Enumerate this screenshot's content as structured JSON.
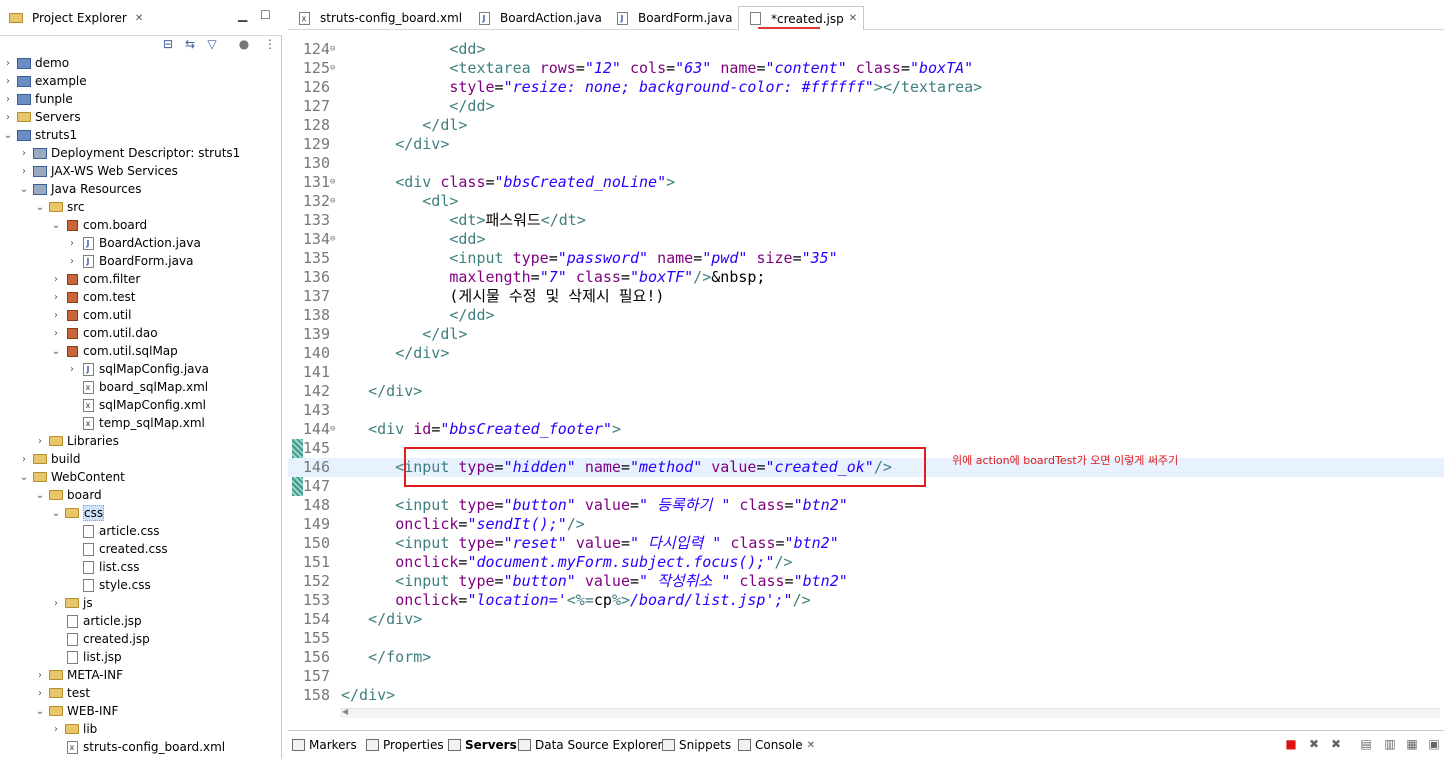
{
  "explorer": {
    "title": "Project Explorer",
    "tree": [
      {
        "label": "demo",
        "depth": 0,
        "arrow": ">",
        "icon": "project"
      },
      {
        "label": "example",
        "depth": 0,
        "arrow": ">",
        "icon": "project"
      },
      {
        "label": "funple",
        "depth": 0,
        "arrow": ">",
        "icon": "project"
      },
      {
        "label": "Servers",
        "depth": 0,
        "arrow": ">",
        "icon": "folder"
      },
      {
        "label": "struts1",
        "depth": 0,
        "arrow": "v",
        "icon": "project"
      },
      {
        "label": "Deployment Descriptor: struts1",
        "depth": 1,
        "arrow": ">",
        "icon": "descriptor"
      },
      {
        "label": "JAX-WS Web Services",
        "depth": 1,
        "arrow": ">",
        "icon": "descriptor"
      },
      {
        "label": "Java Resources",
        "depth": 1,
        "arrow": "v",
        "icon": "descriptor"
      },
      {
        "label": "src",
        "depth": 2,
        "arrow": "v",
        "icon": "folder"
      },
      {
        "label": "com.board",
        "depth": 3,
        "arrow": "v",
        "icon": "package"
      },
      {
        "label": "BoardAction.java",
        "depth": 4,
        "arrow": ">",
        "icon": "java"
      },
      {
        "label": "BoardForm.java",
        "depth": 4,
        "arrow": ">",
        "icon": "java"
      },
      {
        "label": "com.filter",
        "depth": 3,
        "arrow": ">",
        "icon": "package"
      },
      {
        "label": "com.test",
        "depth": 3,
        "arrow": ">",
        "icon": "package"
      },
      {
        "label": "com.util",
        "depth": 3,
        "arrow": ">",
        "icon": "package"
      },
      {
        "label": "com.util.dao",
        "depth": 3,
        "arrow": ">",
        "icon": "package"
      },
      {
        "label": "com.util.sqlMap",
        "depth": 3,
        "arrow": "v",
        "icon": "package"
      },
      {
        "label": "sqlMapConfig.java",
        "depth": 4,
        "arrow": ">",
        "icon": "java"
      },
      {
        "label": "board_sqlMap.xml",
        "depth": 4,
        "arrow": "",
        "icon": "xml"
      },
      {
        "label": "sqlMapConfig.xml",
        "depth": 4,
        "arrow": "",
        "icon": "xml"
      },
      {
        "label": "temp_sqlMap.xml",
        "depth": 4,
        "arrow": "",
        "icon": "xml"
      },
      {
        "label": "Libraries",
        "depth": 2,
        "arrow": ">",
        "icon": "folder"
      },
      {
        "label": "build",
        "depth": 1,
        "arrow": ">",
        "icon": "folder"
      },
      {
        "label": "WebContent",
        "depth": 1,
        "arrow": "v",
        "icon": "folder"
      },
      {
        "label": "board",
        "depth": 2,
        "arrow": "v",
        "icon": "folder"
      },
      {
        "label": "css",
        "depth": 3,
        "arrow": "v",
        "icon": "folder",
        "selected": true
      },
      {
        "label": "article.css",
        "depth": 4,
        "arrow": "",
        "icon": "css"
      },
      {
        "label": "created.css",
        "depth": 4,
        "arrow": "",
        "icon": "css"
      },
      {
        "label": "list.css",
        "depth": 4,
        "arrow": "",
        "icon": "css"
      },
      {
        "label": "style.css",
        "depth": 4,
        "arrow": "",
        "icon": "css"
      },
      {
        "label": "js",
        "depth": 3,
        "arrow": ">",
        "icon": "folder"
      },
      {
        "label": "article.jsp",
        "depth": 3,
        "arrow": "",
        "icon": "css"
      },
      {
        "label": "created.jsp",
        "depth": 3,
        "arrow": "",
        "icon": "css"
      },
      {
        "label": "list.jsp",
        "depth": 3,
        "arrow": "",
        "icon": "css"
      },
      {
        "label": "META-INF",
        "depth": 2,
        "arrow": ">",
        "icon": "folder"
      },
      {
        "label": "test",
        "depth": 2,
        "arrow": ">",
        "icon": "folder"
      },
      {
        "label": "WEB-INF",
        "depth": 2,
        "arrow": "v",
        "icon": "folder"
      },
      {
        "label": "lib",
        "depth": 3,
        "arrow": ">",
        "icon": "folder"
      },
      {
        "label": "struts-config_board.xml",
        "depth": 3,
        "arrow": "",
        "icon": "xml"
      }
    ]
  },
  "editor": {
    "tabs": [
      {
        "label": "struts-config_board.xml",
        "icon": "xml"
      },
      {
        "label": "BoardAction.java",
        "icon": "java"
      },
      {
        "label": "BoardForm.java",
        "icon": "java"
      },
      {
        "label": "*created.jsp",
        "icon": "jsp",
        "active": true
      }
    ],
    "annotation": "위에 action에 boardTest가 오면 이렇게 써주기"
  },
  "code_lines": [
    {
      "n": "124",
      "fold": true,
      "tokens": [
        [
          "k",
          "            "
        ],
        [
          "t",
          "<dd>"
        ]
      ]
    },
    {
      "n": "125",
      "fold": true,
      "tokens": [
        [
          "k",
          "            "
        ],
        [
          "t",
          "<textarea "
        ],
        [
          "a",
          "rows"
        ],
        [
          "k",
          "="
        ],
        [
          "v",
          "\"12\" "
        ],
        [
          "a",
          "cols"
        ],
        [
          "k",
          "="
        ],
        [
          "v",
          "\"63\" "
        ],
        [
          "a",
          "name"
        ],
        [
          "k",
          "="
        ],
        [
          "v",
          "\"content\" "
        ],
        [
          "a",
          "class"
        ],
        [
          "k",
          "="
        ],
        [
          "v",
          "\"boxTA\""
        ]
      ]
    },
    {
      "n": "126",
      "fold": false,
      "tokens": [
        [
          "k",
          "            "
        ],
        [
          "a",
          "style"
        ],
        [
          "k",
          "="
        ],
        [
          "v",
          "\"resize: none; background-color: #ffffff\""
        ],
        [
          "t",
          "></textarea>"
        ]
      ]
    },
    {
      "n": "127",
      "fold": false,
      "tokens": [
        [
          "k",
          "            "
        ],
        [
          "t",
          "</dd>"
        ]
      ]
    },
    {
      "n": "128",
      "fold": false,
      "tokens": [
        [
          "k",
          "         "
        ],
        [
          "t",
          "</dl>"
        ]
      ]
    },
    {
      "n": "129",
      "fold": false,
      "tokens": [
        [
          "k",
          "      "
        ],
        [
          "t",
          "</div>"
        ]
      ]
    },
    {
      "n": "130",
      "fold": false,
      "tokens": [
        [
          "k",
          ""
        ]
      ]
    },
    {
      "n": "131",
      "fold": true,
      "tokens": [
        [
          "k",
          "      "
        ],
        [
          "t",
          "<div "
        ],
        [
          "a",
          "class"
        ],
        [
          "k",
          "="
        ],
        [
          "v",
          "\"bbsCreated_noLine\""
        ],
        [
          "t",
          ">"
        ]
      ]
    },
    {
      "n": "132",
      "fold": true,
      "tokens": [
        [
          "k",
          "         "
        ],
        [
          "t",
          "<dl>"
        ]
      ]
    },
    {
      "n": "133",
      "fold": false,
      "tokens": [
        [
          "k",
          "            "
        ],
        [
          "t",
          "<dt>"
        ],
        [
          "k",
          "패스워드"
        ],
        [
          "t",
          "</dt>"
        ]
      ]
    },
    {
      "n": "134",
      "fold": true,
      "tokens": [
        [
          "k",
          "            "
        ],
        [
          "t",
          "<dd>"
        ]
      ]
    },
    {
      "n": "135",
      "fold": false,
      "tokens": [
        [
          "k",
          "            "
        ],
        [
          "t",
          "<input "
        ],
        [
          "a",
          "type"
        ],
        [
          "k",
          "="
        ],
        [
          "v",
          "\"password\" "
        ],
        [
          "a",
          "name"
        ],
        [
          "k",
          "="
        ],
        [
          "v",
          "\"pwd\" "
        ],
        [
          "a",
          "size"
        ],
        [
          "k",
          "="
        ],
        [
          "v",
          "\"35\""
        ]
      ]
    },
    {
      "n": "136",
      "fold": false,
      "tokens": [
        [
          "k",
          "            "
        ],
        [
          "a",
          "maxlength"
        ],
        [
          "k",
          "="
        ],
        [
          "v",
          "\"7\" "
        ],
        [
          "a",
          "class"
        ],
        [
          "k",
          "="
        ],
        [
          "v",
          "\"boxTF\""
        ],
        [
          "t",
          "/>"
        ],
        [
          "k",
          "&nbsp;"
        ]
      ]
    },
    {
      "n": "137",
      "fold": false,
      "tokens": [
        [
          "k",
          "            (게시물 수정 및 삭제시 필요!)"
        ]
      ]
    },
    {
      "n": "138",
      "fold": false,
      "tokens": [
        [
          "k",
          "            "
        ],
        [
          "t",
          "</dd>"
        ]
      ]
    },
    {
      "n": "139",
      "fold": false,
      "tokens": [
        [
          "k",
          "         "
        ],
        [
          "t",
          "</dl>"
        ]
      ]
    },
    {
      "n": "140",
      "fold": false,
      "tokens": [
        [
          "k",
          "      "
        ],
        [
          "t",
          "</div>"
        ]
      ]
    },
    {
      "n": "141",
      "fold": false,
      "tokens": [
        [
          "k",
          ""
        ]
      ]
    },
    {
      "n": "142",
      "fold": false,
      "tokens": [
        [
          "k",
          "   "
        ],
        [
          "t",
          "</div>"
        ]
      ]
    },
    {
      "n": "143",
      "fold": false,
      "tokens": [
        [
          "k",
          ""
        ]
      ]
    },
    {
      "n": "144",
      "fold": true,
      "tokens": [
        [
          "k",
          "   "
        ],
        [
          "t",
          "<div "
        ],
        [
          "a",
          "id"
        ],
        [
          "k",
          "="
        ],
        [
          "v",
          "\"bbsCreated_footer\""
        ],
        [
          "t",
          ">"
        ]
      ]
    },
    {
      "n": "145",
      "fold": false,
      "tokens": [
        [
          "k",
          ""
        ]
      ]
    },
    {
      "n": "146",
      "fold": false,
      "hl": true,
      "tokens": [
        [
          "k",
          "      "
        ],
        [
          "t",
          "<input "
        ],
        [
          "a",
          "type"
        ],
        [
          "k",
          "="
        ],
        [
          "v",
          "\"hidden\" "
        ],
        [
          "a",
          "name"
        ],
        [
          "k",
          "="
        ],
        [
          "v",
          "\"method\" "
        ],
        [
          "a",
          "value"
        ],
        [
          "k",
          "="
        ],
        [
          "v",
          "\"created_ok\""
        ],
        [
          "t",
          "/>"
        ]
      ]
    },
    {
      "n": "147",
      "fold": false,
      "tokens": [
        [
          "k",
          ""
        ]
      ]
    },
    {
      "n": "148",
      "fold": false,
      "tokens": [
        [
          "k",
          "      "
        ],
        [
          "t",
          "<input "
        ],
        [
          "a",
          "type"
        ],
        [
          "k",
          "="
        ],
        [
          "v",
          "\"button\" "
        ],
        [
          "a",
          "value"
        ],
        [
          "k",
          "="
        ],
        [
          "v",
          "\" 등록하기 \" "
        ],
        [
          "a",
          "class"
        ],
        [
          "k",
          "="
        ],
        [
          "v",
          "\"btn2\""
        ]
      ]
    },
    {
      "n": "149",
      "fold": false,
      "tokens": [
        [
          "k",
          "      "
        ],
        [
          "a",
          "onclick"
        ],
        [
          "k",
          "="
        ],
        [
          "v",
          "\"sendIt();\""
        ],
        [
          "t",
          "/>"
        ]
      ]
    },
    {
      "n": "150",
      "fold": false,
      "tokens": [
        [
          "k",
          "      "
        ],
        [
          "t",
          "<input "
        ],
        [
          "a",
          "type"
        ],
        [
          "k",
          "="
        ],
        [
          "v",
          "\"reset\" "
        ],
        [
          "a",
          "value"
        ],
        [
          "k",
          "="
        ],
        [
          "v",
          "\" 다시입력 \" "
        ],
        [
          "a",
          "class"
        ],
        [
          "k",
          "="
        ],
        [
          "v",
          "\"btn2\""
        ]
      ]
    },
    {
      "n": "151",
      "fold": false,
      "tokens": [
        [
          "k",
          "      "
        ],
        [
          "a",
          "onclick"
        ],
        [
          "k",
          "="
        ],
        [
          "v",
          "\"document.myForm.subject.focus();\""
        ],
        [
          "t",
          "/>"
        ]
      ]
    },
    {
      "n": "152",
      "fold": false,
      "tokens": [
        [
          "k",
          "      "
        ],
        [
          "t",
          "<input "
        ],
        [
          "a",
          "type"
        ],
        [
          "k",
          "="
        ],
        [
          "v",
          "\"button\" "
        ],
        [
          "a",
          "value"
        ],
        [
          "k",
          "="
        ],
        [
          "v",
          "\" 작성취소 \" "
        ],
        [
          "a",
          "class"
        ],
        [
          "k",
          "="
        ],
        [
          "v",
          "\"btn2\""
        ]
      ]
    },
    {
      "n": "153",
      "fold": false,
      "tokens": [
        [
          "k",
          "      "
        ],
        [
          "a",
          "onclick"
        ],
        [
          "k",
          "="
        ],
        [
          "v",
          "\"location='"
        ],
        [
          "t",
          "<%="
        ],
        [
          "k",
          "cp"
        ],
        [
          "t",
          "%>"
        ],
        [
          "v",
          "/board/list.jsp';\""
        ],
        [
          "t",
          "/>"
        ]
      ]
    },
    {
      "n": "154",
      "fold": false,
      "tokens": [
        [
          "k",
          "   "
        ],
        [
          "t",
          "</div>"
        ]
      ]
    },
    {
      "n": "155",
      "fold": false,
      "tokens": [
        [
          "k",
          ""
        ]
      ]
    },
    {
      "n": "156",
      "fold": false,
      "tokens": [
        [
          "k",
          "   "
        ],
        [
          "t",
          "</form>"
        ]
      ]
    },
    {
      "n": "157",
      "fold": false,
      "tokens": [
        [
          "k",
          ""
        ]
      ]
    },
    {
      "n": "158",
      "fold": false,
      "tokens": [
        [
          "t",
          "</div>"
        ]
      ]
    }
  ],
  "bottom_tabs": [
    {
      "label": "Markers"
    },
    {
      "label": "Properties"
    },
    {
      "label": "Servers",
      "active": true
    },
    {
      "label": "Data Source Explorer"
    },
    {
      "label": "Snippets"
    },
    {
      "label": "Console",
      "close": true
    }
  ]
}
